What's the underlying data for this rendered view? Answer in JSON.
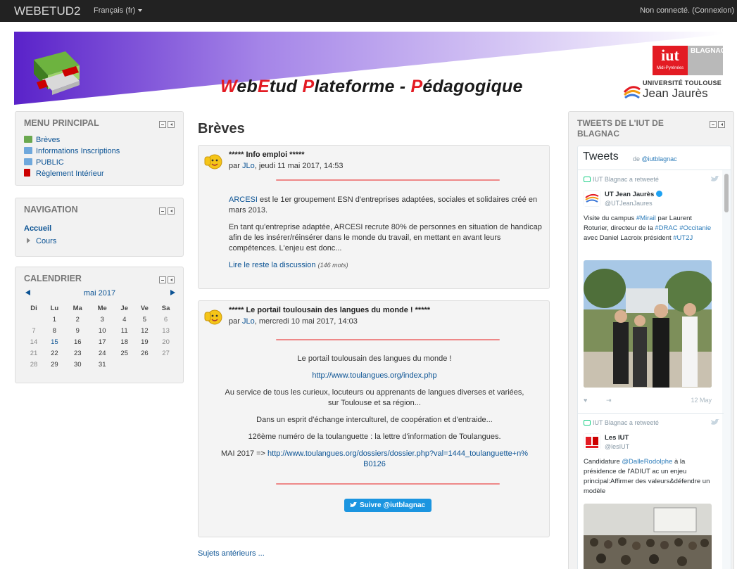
{
  "navbar": {
    "brand": "WEBETUD2",
    "language": "Français (fr)",
    "login_status": "Non connecté. (Connexion)"
  },
  "banner": {
    "title_parts": [
      "W",
      "eb",
      "E",
      "tud ",
      "P",
      "lateforme - ",
      "P",
      "édagogique"
    ],
    "iut_logo": "iut",
    "iut_logo_sub": "Midi-Pyrénées",
    "iut_city": "BLAGNAC",
    "univ_line1": "UNIVERSITÉ TOULOUSE",
    "univ_line2": "Jean Jaurès"
  },
  "main_menu": {
    "title": "MENU PRINCIPAL",
    "items": [
      {
        "label": "Brèves",
        "icon": "forum-icon",
        "color": "#6aa84f"
      },
      {
        "label": "Informations Inscriptions",
        "icon": "folder-icon",
        "color": "#6fa8dc"
      },
      {
        "label": "PUBLIC",
        "icon": "folder-icon",
        "color": "#6fa8dc"
      },
      {
        "label": "Règlement Intérieur",
        "icon": "pdf-icon",
        "color": "#cc0000"
      }
    ]
  },
  "navigation": {
    "title": "NAVIGATION",
    "home": "Accueil",
    "courses": "Cours"
  },
  "calendar": {
    "title": "CALENDRIER",
    "month": "mai 2017",
    "days": [
      "Di",
      "Lu",
      "Ma",
      "Me",
      "Je",
      "Ve",
      "Sa"
    ],
    "weeks": [
      [
        "",
        "1",
        "2",
        "3",
        "4",
        "5",
        "6"
      ],
      [
        "7",
        "8",
        "9",
        "10",
        "11",
        "12",
        "13"
      ],
      [
        "14",
        "15",
        "16",
        "17",
        "18",
        "19",
        "20"
      ],
      [
        "21",
        "22",
        "23",
        "24",
        "25",
        "26",
        "27"
      ],
      [
        "28",
        "29",
        "30",
        "31",
        "",
        "",
        ""
      ]
    ],
    "today": "15"
  },
  "main": {
    "page_title": "Brèves",
    "posts": [
      {
        "title": "***** Info emploi *****",
        "by_prefix": "par ",
        "author": "JLo",
        "date": ", jeudi 11 mai 2017, 14:53",
        "para1_link": "ARCESI",
        "para1_rest": " est le 1er groupement ESN d'entreprises adaptées, sociales et solidaires créé en mars 2013.",
        "para2": "En tant qu'entreprise adaptée, ARCESI recrute 80% de personnes en situation de handicap afin de les insérer/réinsérer dans le monde du travail, en mettant en avant leurs compétences. L'enjeu est donc...",
        "read_more": "Lire le reste la discussion",
        "word_count": "(146 mots)"
      },
      {
        "title": "***** Le portail toulousain des langues du monde ! *****",
        "by_prefix": "par ",
        "author": "JLo",
        "date": ", mercredi 10 mai 2017, 14:03",
        "line1": "Le portail toulousain des langues du monde !",
        "link1": "http://www.toulangues.org/index.php",
        "line2": "Au service de tous les curieux, locuteurs ou apprenants de langues diverses et variées, sur Toulouse et sa région...",
        "line3": "Dans un esprit d'échange interculturel, de coopération et d'entraide...",
        "line4": "126ème numéro de la toulanguette : la lettre d'information de Toulangues.",
        "line5_prefix": "MAI 2017 => ",
        "link2": "http://www.toulangues.org/dossiers/dossier.php?val=1444_toulanguette+n%B0126",
        "follow_button": "Suivre @iutblagnac"
      }
    ],
    "older_topics": "Sujets antérieurs ..."
  },
  "tweets_block": {
    "title": "TWEETS DE L'IUT DE BLAGNAC",
    "widget_title": "Tweets",
    "widget_by_prefix": "de ",
    "widget_by_handle": "@iutblagnac",
    "tweets": [
      {
        "retweet_label": "IUT Blagnac a retweeté",
        "name": "UT Jean Jaurès",
        "handle": "@UTJeanJaures",
        "text_parts": [
          "Visite du campus ",
          "#Mirail",
          " par Laurent Roturier, directeur de la ",
          "#DRAC",
          " ",
          "#Occitanie",
          " avec Daniel Lacroix président ",
          "#UT2J"
        ],
        "date": "12 May"
      },
      {
        "retweet_label": "IUT Blagnac a retweeté",
        "name": "Les IUT",
        "handle": "@lesIUT",
        "text_parts": [
          "Candidature ",
          "@DalleRodolphe",
          " à la présidence de l'ADIUT ac un enjeu principal:Affirmer des valeurs&défendre un modèle"
        ]
      }
    ]
  }
}
